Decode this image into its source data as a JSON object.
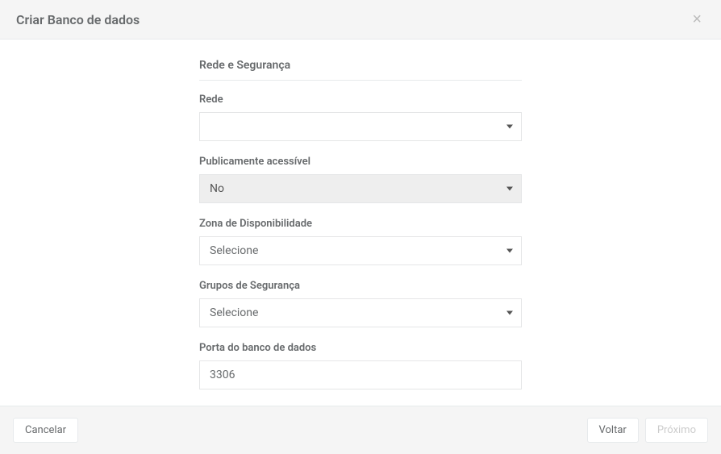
{
  "header": {
    "title": "Criar Banco de dados"
  },
  "section": {
    "title": "Rede e Segurança"
  },
  "fields": {
    "network": {
      "label": "Rede",
      "value": ""
    },
    "publicly_accessible": {
      "label": "Publicamente acessível",
      "value": "No"
    },
    "availability_zone": {
      "label": "Zona de Disponibilidade",
      "value": "Selecione"
    },
    "security_groups": {
      "label": "Grupos de Segurança",
      "value": "Selecione"
    },
    "db_port": {
      "label": "Porta do banco de dados",
      "value": "3306"
    }
  },
  "footer": {
    "cancel": "Cancelar",
    "back": "Voltar",
    "next": "Próximo"
  }
}
